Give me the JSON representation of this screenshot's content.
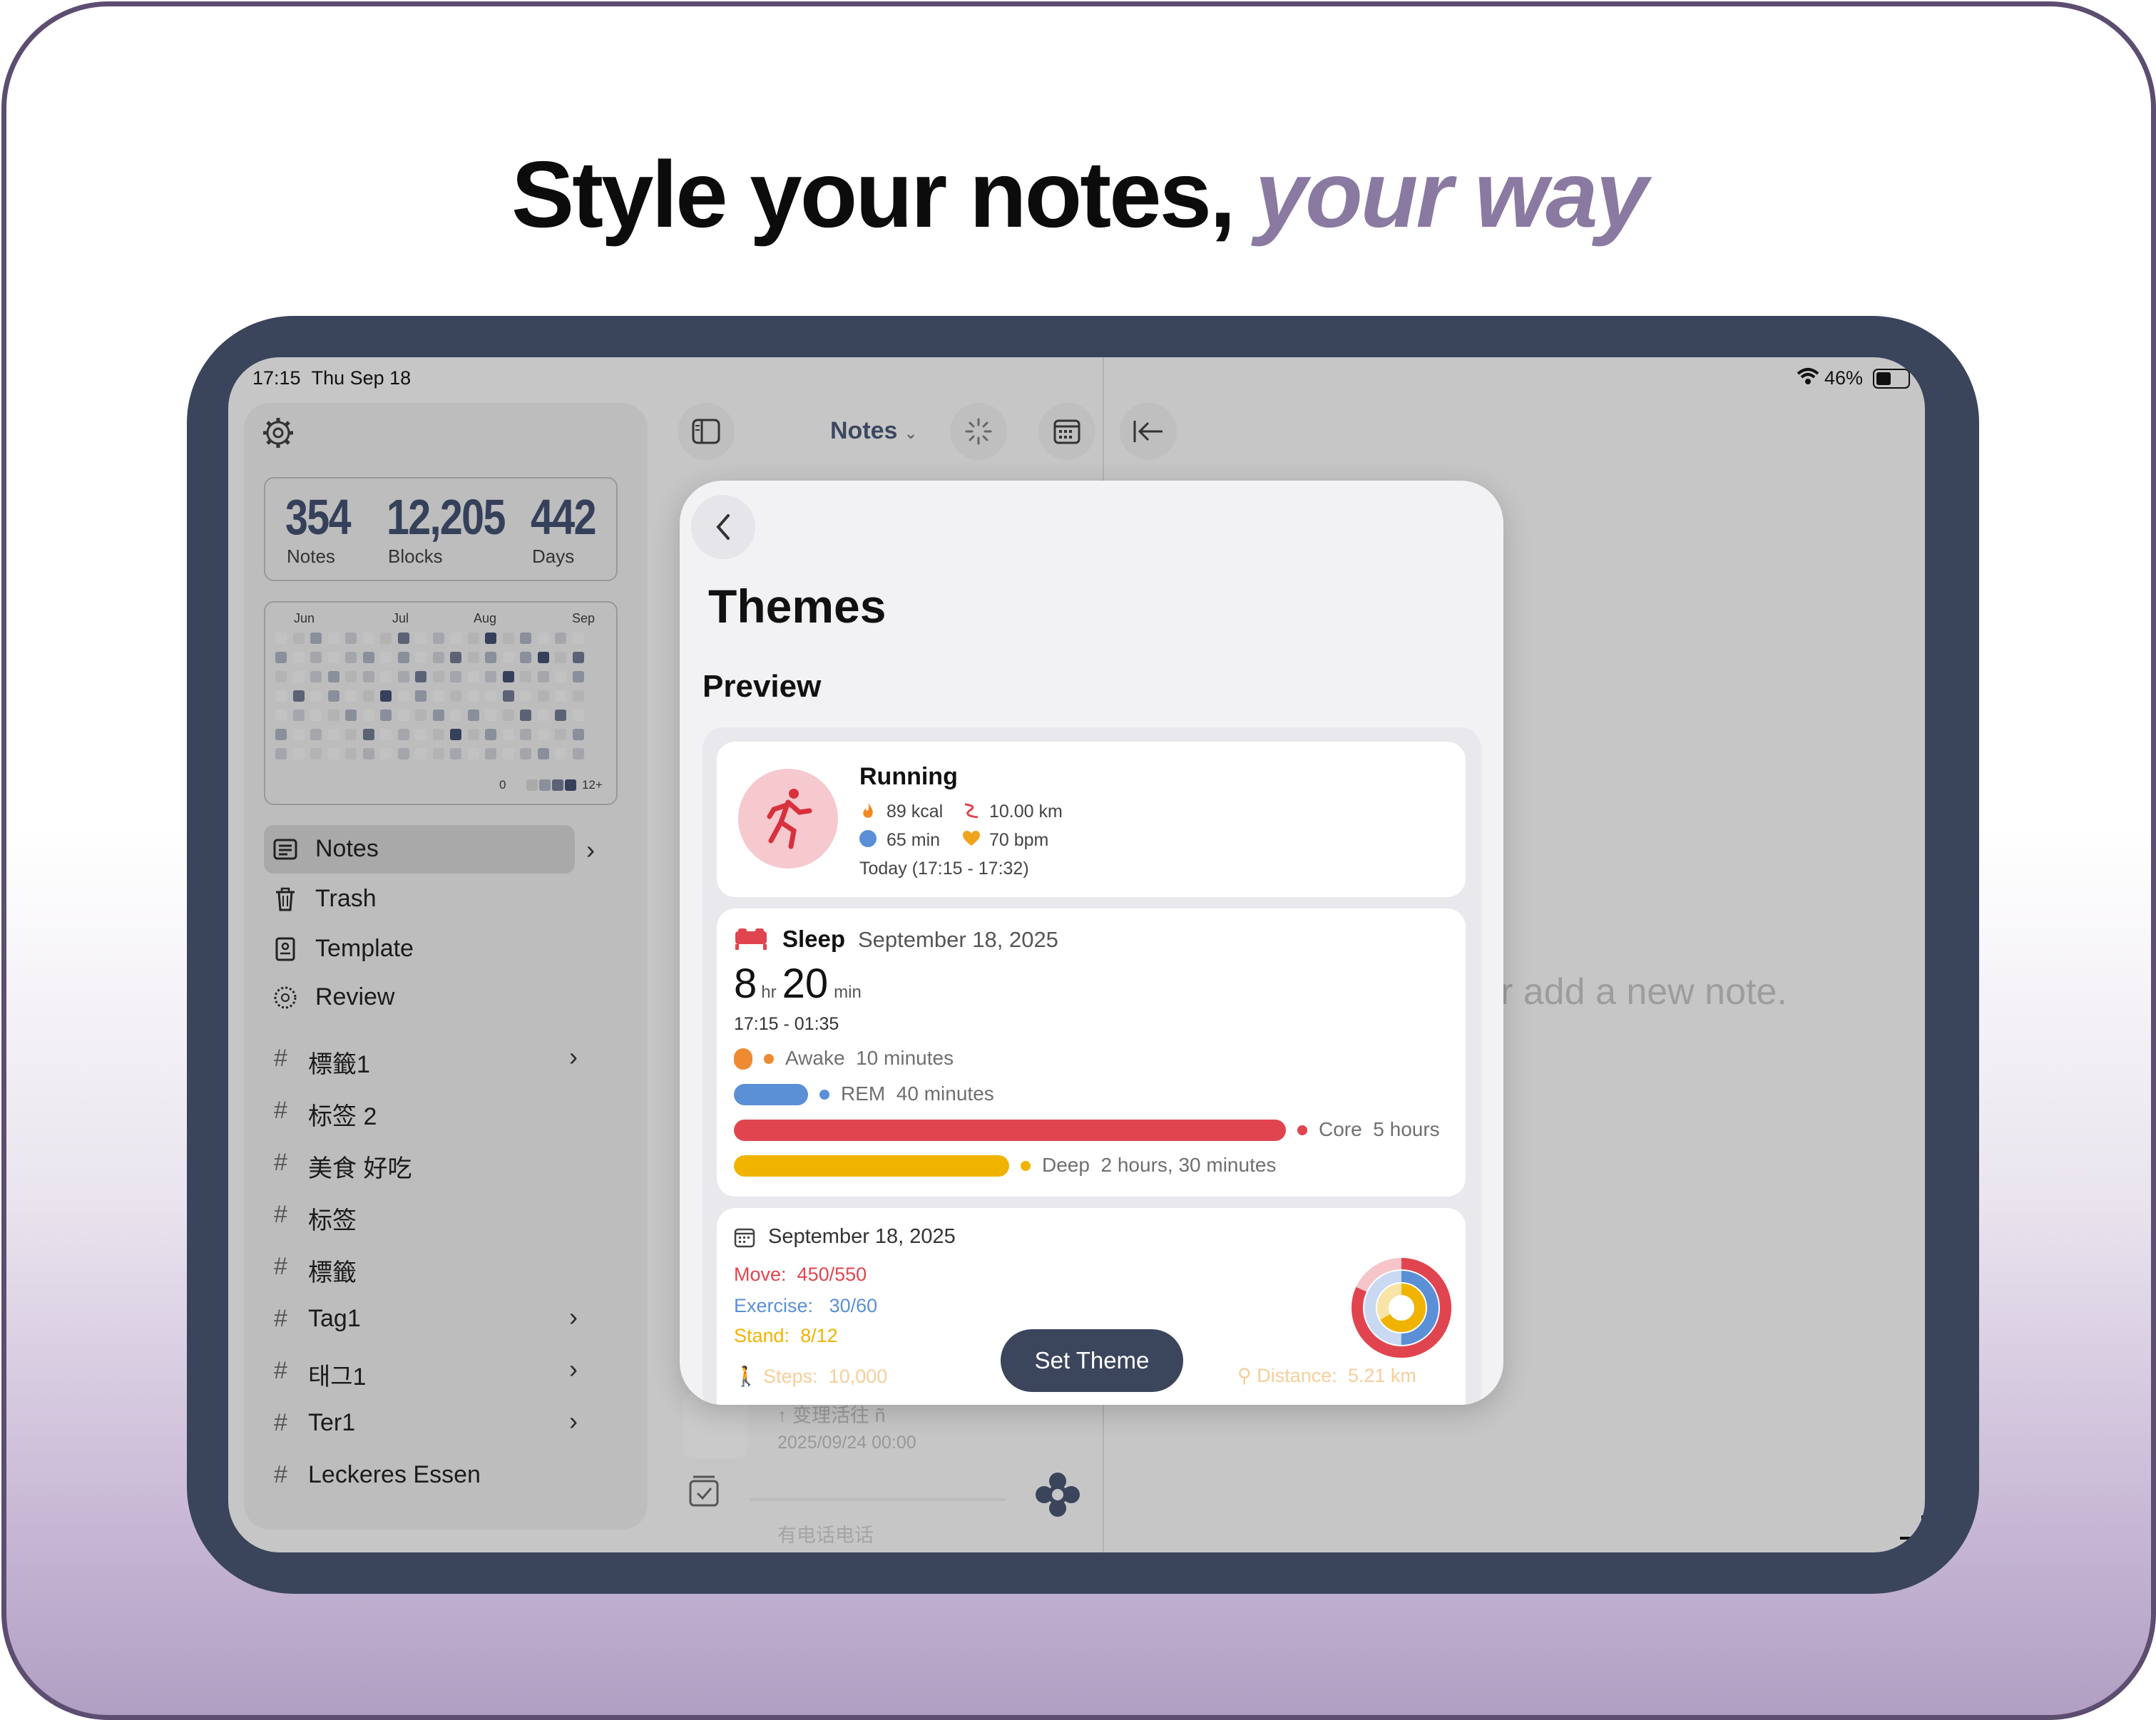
{
  "headline": {
    "main": "Style your notes,",
    "accent": "your way"
  },
  "statusbar": {
    "time": "17:15",
    "date": "Thu Sep 18",
    "battery": "46%"
  },
  "stats": [
    {
      "value": "354",
      "label": "Notes"
    },
    {
      "value": "12,205",
      "label": "Blocks"
    },
    {
      "value": "442",
      "label": "Days"
    }
  ],
  "heatmap": {
    "months": [
      "Jun",
      "Jul",
      "Aug",
      "Sep"
    ],
    "legend_min": "0",
    "legend_max": "12+"
  },
  "nav": [
    {
      "label": "Notes",
      "icon": "notes-icon"
    },
    {
      "label": "Trash",
      "icon": "trash-icon"
    },
    {
      "label": "Template",
      "icon": "template-icon"
    },
    {
      "label": "Review",
      "icon": "review-icon"
    }
  ],
  "tags": [
    {
      "label": "標籤1",
      "chevron": true
    },
    {
      "label": "标签 2",
      "chevron": false
    },
    {
      "label": "美食 好吃",
      "chevron": false
    },
    {
      "label": "标签",
      "chevron": false
    },
    {
      "label": "標籤",
      "chevron": false
    },
    {
      "label": "Tag1",
      "chevron": true
    },
    {
      "label": "태그1",
      "chevron": true
    },
    {
      "label": "Ter1",
      "chevron": true
    },
    {
      "label": "Leckeres Essen",
      "chevron": false
    }
  ],
  "middle": {
    "title": "Notes",
    "list_item_title": "↑ 变理活往 ñ",
    "list_item_date": "2025/09/24 00:00",
    "list_item2_title": "有电话电话"
  },
  "detail": {
    "empty_hint": "r add a new note."
  },
  "modal": {
    "title": "Themes",
    "section": "Preview",
    "running": {
      "title": "Running",
      "kcal": "89 kcal",
      "distance": "10.00 km",
      "duration": "65 min",
      "heart": "70 bpm",
      "time": "Today (17:15 - 17:32)"
    },
    "sleep": {
      "title": "Sleep",
      "date": "September 18, 2025",
      "hours": "8",
      "hr_unit": "hr",
      "minutes": "20",
      "min_unit": "min",
      "range": "17:15 - 01:35",
      "stages": [
        {
          "name": "Awake",
          "value": "10 minutes"
        },
        {
          "name": "REM",
          "value": "40 minutes"
        },
        {
          "name": "Core",
          "value": "5 hours"
        },
        {
          "name": "Deep",
          "value": "2 hours, 30 minutes"
        }
      ]
    },
    "activity": {
      "date": "September 18, 2025",
      "move_label": "Move:",
      "move_value": "450/550",
      "exercise_label": "Exercise:",
      "exercise_value": "30/60",
      "stand_label": "Stand:",
      "stand_value": "8/12",
      "steps_label": "Steps:",
      "steps_value": "10,000",
      "distance_label": "Distance:",
      "distance_value": "5.21 km"
    },
    "button": "Set Theme"
  },
  "colors": {
    "accent": "#8a7aa2",
    "frame": "#3a455c",
    "stat": "#35405a",
    "move": "#e0454f",
    "exercise": "#5b8fd6",
    "stand": "#f0b400",
    "awake": "#ee8a32",
    "button": "#3b465c"
  }
}
